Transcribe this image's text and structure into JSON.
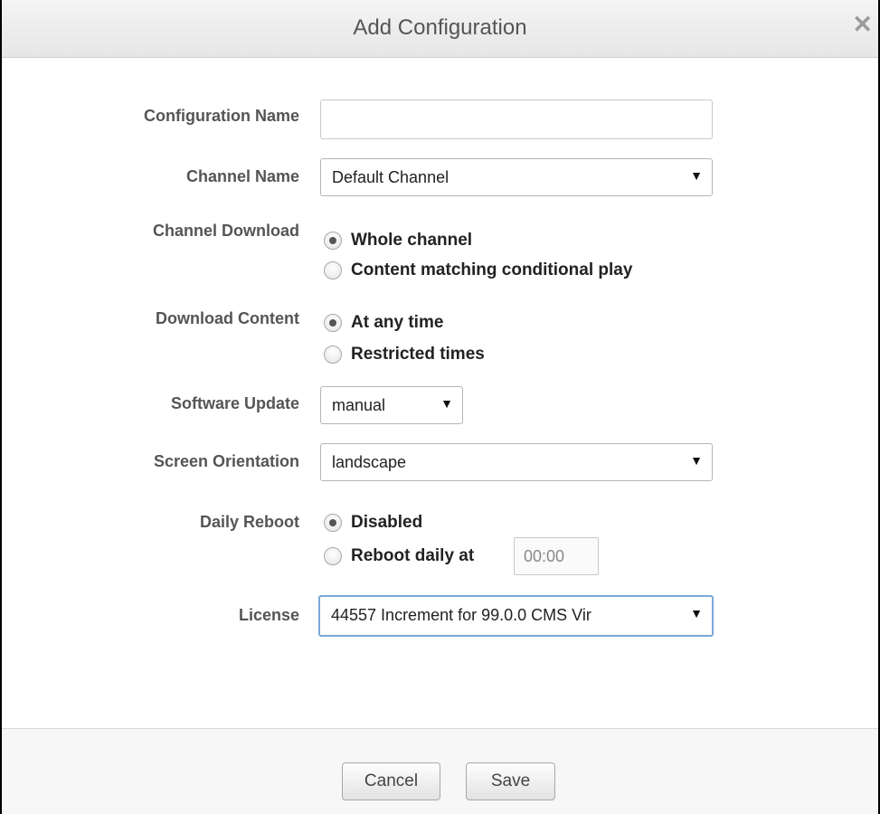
{
  "dialog": {
    "title": "Add Configuration",
    "close_glyph": "✕"
  },
  "form": {
    "configuration_name": {
      "label": "Configuration Name",
      "value": "",
      "placeholder": ""
    },
    "channel_name": {
      "label": "Channel Name",
      "selected": "Default Channel"
    },
    "channel_download": {
      "label": "Channel Download",
      "options": [
        {
          "label": "Whole channel",
          "checked": true
        },
        {
          "label": "Content matching conditional play",
          "checked": false
        }
      ]
    },
    "download_content": {
      "label": "Download Content",
      "options": [
        {
          "label": "At any time",
          "checked": true
        },
        {
          "label": "Restricted times",
          "checked": false
        }
      ]
    },
    "software_update": {
      "label": "Software Update",
      "selected": "manual"
    },
    "screen_orientation": {
      "label": "Screen Orientation",
      "selected": "landscape"
    },
    "daily_reboot": {
      "label": "Daily Reboot",
      "options": [
        {
          "label": "Disabled",
          "checked": true
        },
        {
          "label": "Reboot daily at",
          "checked": false
        }
      ],
      "time_value": "00:00"
    },
    "license": {
      "label": "License",
      "selected": "44557 Increment for 99.0.0 CMS Vir"
    }
  },
  "footer": {
    "cancel_label": "Cancel",
    "save_label": "Save"
  },
  "icons": {
    "dropdown_arrow": "▼"
  }
}
